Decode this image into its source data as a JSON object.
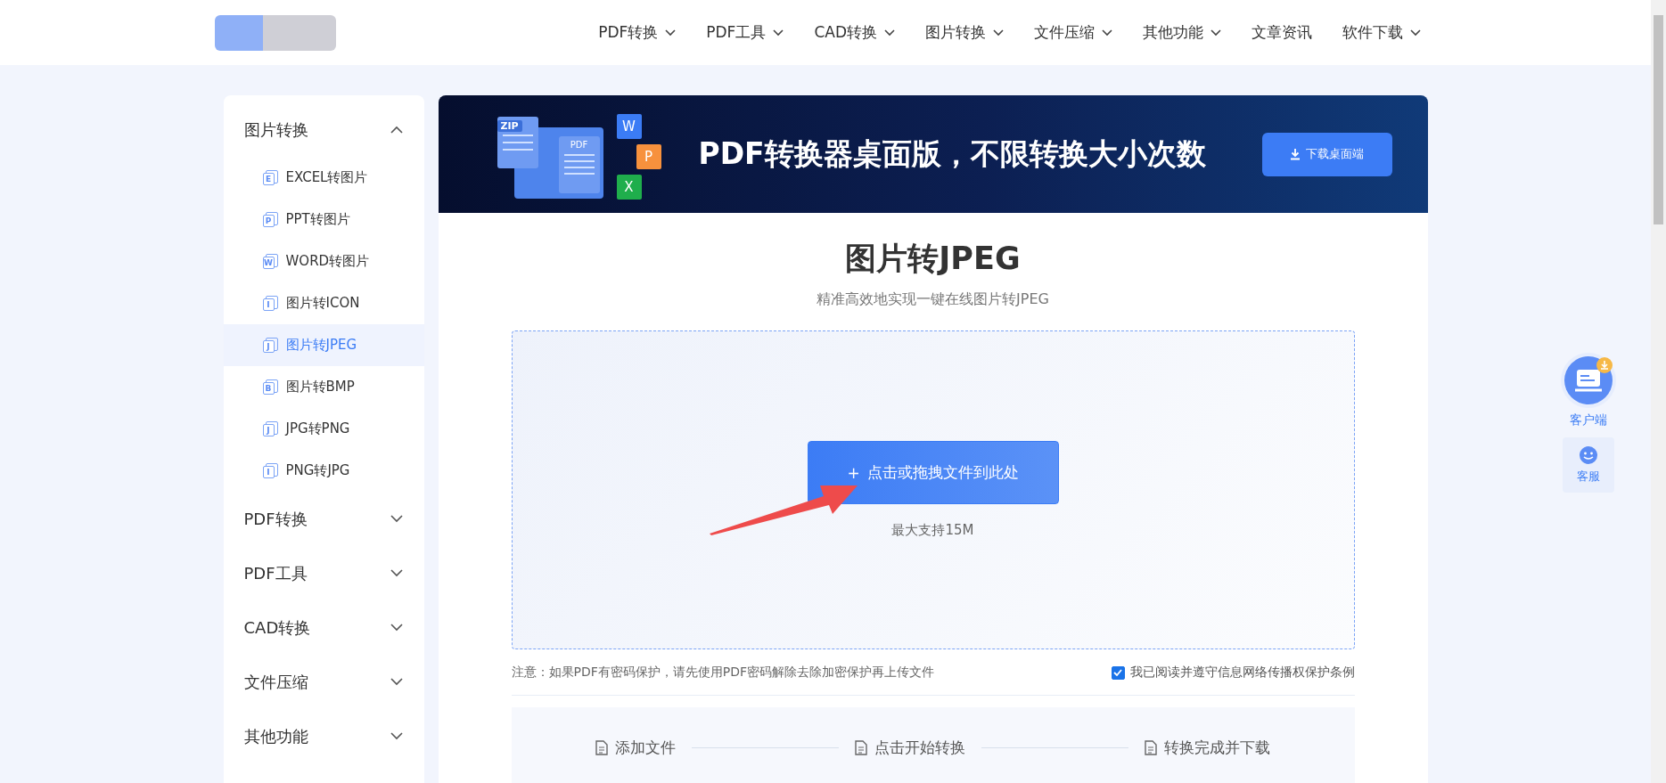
{
  "nav": [
    {
      "label": "PDF转换",
      "dropdown": true
    },
    {
      "label": "PDF工具",
      "dropdown": true
    },
    {
      "label": "CAD转换",
      "dropdown": true
    },
    {
      "label": "图片转换",
      "dropdown": true
    },
    {
      "label": "文件压缩",
      "dropdown": true
    },
    {
      "label": "其他功能",
      "dropdown": true
    },
    {
      "label": "文章资讯",
      "dropdown": false
    },
    {
      "label": "软件下载",
      "dropdown": true
    }
  ],
  "sidebar": {
    "groups": [
      {
        "label": "图片转换",
        "expanded": true,
        "children": [
          {
            "label": "EXCEL转图片",
            "icon_letter": "E",
            "selected": false
          },
          {
            "label": "PPT转图片",
            "icon_letter": "P",
            "selected": false
          },
          {
            "label": "WORD转图片",
            "icon_letter": "W",
            "selected": false
          },
          {
            "label": "图片转ICON",
            "icon_letter": "I",
            "selected": false
          },
          {
            "label": "图片转JPEG",
            "icon_letter": "J",
            "selected": true
          },
          {
            "label": "图片转BMP",
            "icon_letter": "B",
            "selected": false
          },
          {
            "label": "JPG转PNG",
            "icon_letter": "J",
            "selected": false
          },
          {
            "label": "PNG转JPG",
            "icon_letter": "I",
            "selected": false
          }
        ]
      },
      {
        "label": "PDF转换",
        "expanded": false
      },
      {
        "label": "PDF工具",
        "expanded": false
      },
      {
        "label": "CAD转换",
        "expanded": false
      },
      {
        "label": "文件压缩",
        "expanded": false
      },
      {
        "label": "其他功能",
        "expanded": false
      }
    ]
  },
  "banner": {
    "file_labels": [
      "ZIP",
      "PDF"
    ],
    "app_badges": [
      {
        "letter": "W",
        "color": "#3b7cf5"
      },
      {
        "letter": "P",
        "color": "#f7913d"
      },
      {
        "letter": "X",
        "color": "#1fae4c"
      }
    ],
    "title": "PDF转换器桌面版，不限转换大小次数",
    "button": "下载桌面端"
  },
  "tool": {
    "title": "图片转JPEG",
    "subtitle": "精准高效地实现一键在线图片转JPEG",
    "upload_button": {
      "plus": "+",
      "label": "点击或拖拽文件到此处"
    },
    "limit": "最大支持15M",
    "note": "注意：如果PDF有密码保护，请先使用PDF密码解除去除加密保护再上传文件",
    "agreement": {
      "label": "我已阅读并遵守信息网络传播权保护条例",
      "checked": true
    },
    "steps": [
      "添加文件",
      "点击开始转换",
      "转换完成并下载"
    ]
  },
  "float": {
    "client": "客户端",
    "service": "客服"
  }
}
